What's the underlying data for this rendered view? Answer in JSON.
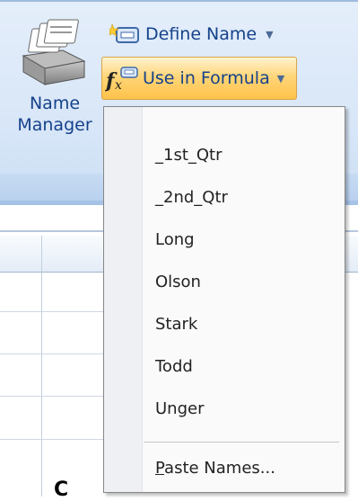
{
  "ribbon": {
    "name_manager": {
      "line1": "Name",
      "line2": "Manager",
      "icon": "name-manager-icon"
    },
    "define_name": {
      "label": "Define Name",
      "icon": "define-name-icon"
    },
    "use_in_formula": {
      "label": "Use in Formula",
      "icon": "fx-icon"
    }
  },
  "menu": {
    "items": [
      "_1st_Qtr",
      "_2nd_Qtr",
      "Long",
      "Olson",
      "Stark",
      "Todd",
      "Unger"
    ],
    "paste_names": {
      "mnemonic": "P",
      "rest": "aste Names..."
    }
  },
  "sheet": {
    "visible_cell_text": "C"
  },
  "colors": {
    "accent": "#ffc24a",
    "ribbon_text": "#15428b"
  }
}
